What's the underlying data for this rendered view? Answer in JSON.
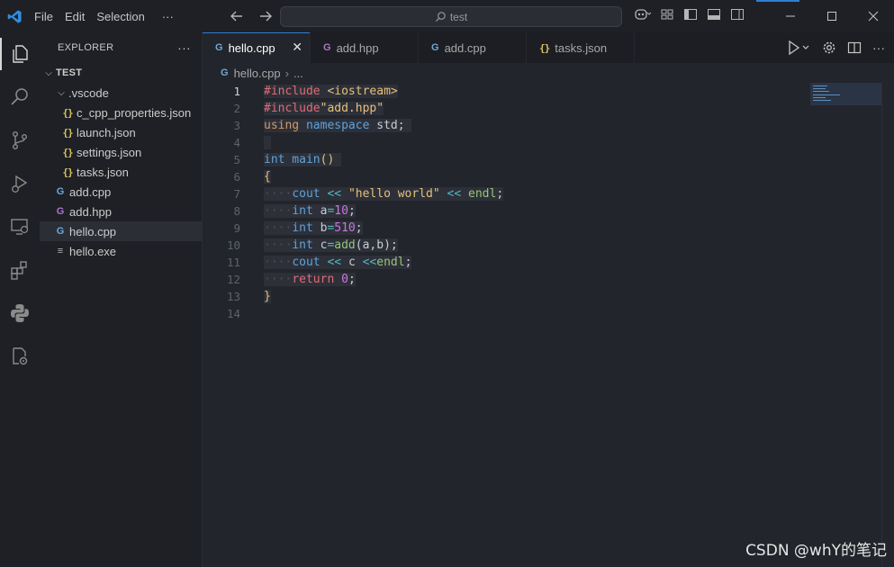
{
  "titlebar": {
    "menu": [
      "File",
      "Edit",
      "Selection",
      "···"
    ],
    "search_text": "test"
  },
  "sidebar": {
    "title": "EXPLORER",
    "more": "···",
    "folder": "TEST",
    "items": [
      {
        "label": ".vscode",
        "kind": "folder"
      },
      {
        "label": "c_cpp_properties.json",
        "kind": "json"
      },
      {
        "label": "launch.json",
        "kind": "json"
      },
      {
        "label": "settings.json",
        "kind": "json"
      },
      {
        "label": "tasks.json",
        "kind": "json"
      },
      {
        "label": "add.cpp",
        "kind": "cpp"
      },
      {
        "label": "add.hpp",
        "kind": "hpp"
      },
      {
        "label": "hello.cpp",
        "kind": "cpp"
      },
      {
        "label": "hello.exe",
        "kind": "exe"
      }
    ]
  },
  "tabs": [
    {
      "label": "hello.cpp",
      "kind": "cpp"
    },
    {
      "label": "add.hpp",
      "kind": "hpp"
    },
    {
      "label": "add.cpp",
      "kind": "cpp"
    },
    {
      "label": "tasks.json",
      "kind": "json"
    }
  ],
  "breadcrumb": {
    "file": "hello.cpp",
    "rest": "..."
  },
  "code": {
    "line_numbers": [
      "1",
      "2",
      "3",
      "4",
      "5",
      "6",
      "7",
      "8",
      "9",
      "10",
      "11",
      "12",
      "13",
      "14"
    ],
    "current_line": "1",
    "l1a": "#include ",
    "l1b": "<iostream>",
    "l2a": "#include",
    "l2b": "\"add.hpp\"",
    "l3a": "using",
    "l3b": "namespace",
    "l3c": " std;",
    "l5a": "int",
    "l5b": " main",
    "l5c": "()",
    "l6": "{",
    "l7a": "cout",
    "l7b": " << ",
    "l7c": "\"hello world\"",
    "l7d": " << ",
    "l7e": "endl",
    "l7f": ";",
    "l8a": "int",
    "l8b": " a",
    "l8c": "=",
    "l8d": "10",
    "l8e": ";",
    "l9a": "int",
    "l9b": " b",
    "l9c": "=",
    "l9d": "510",
    "l9e": ";",
    "l10a": "int",
    "l10b": " c",
    "l10c": "=",
    "l10d": "add",
    "l10e": "(a,b);",
    "l11a": "cout",
    "l11b": " << ",
    "l11c": "c",
    "l11d": " <<",
    "l11e": "endl",
    "l11f": ";",
    "l12a": "return",
    "l12b": " ",
    "l12c": "0",
    "l12d": ";",
    "l13": "}"
  },
  "watermark": "CSDN @whY的笔记",
  "colors": {
    "accent": "#2f7fd6",
    "background": "#22252b"
  }
}
